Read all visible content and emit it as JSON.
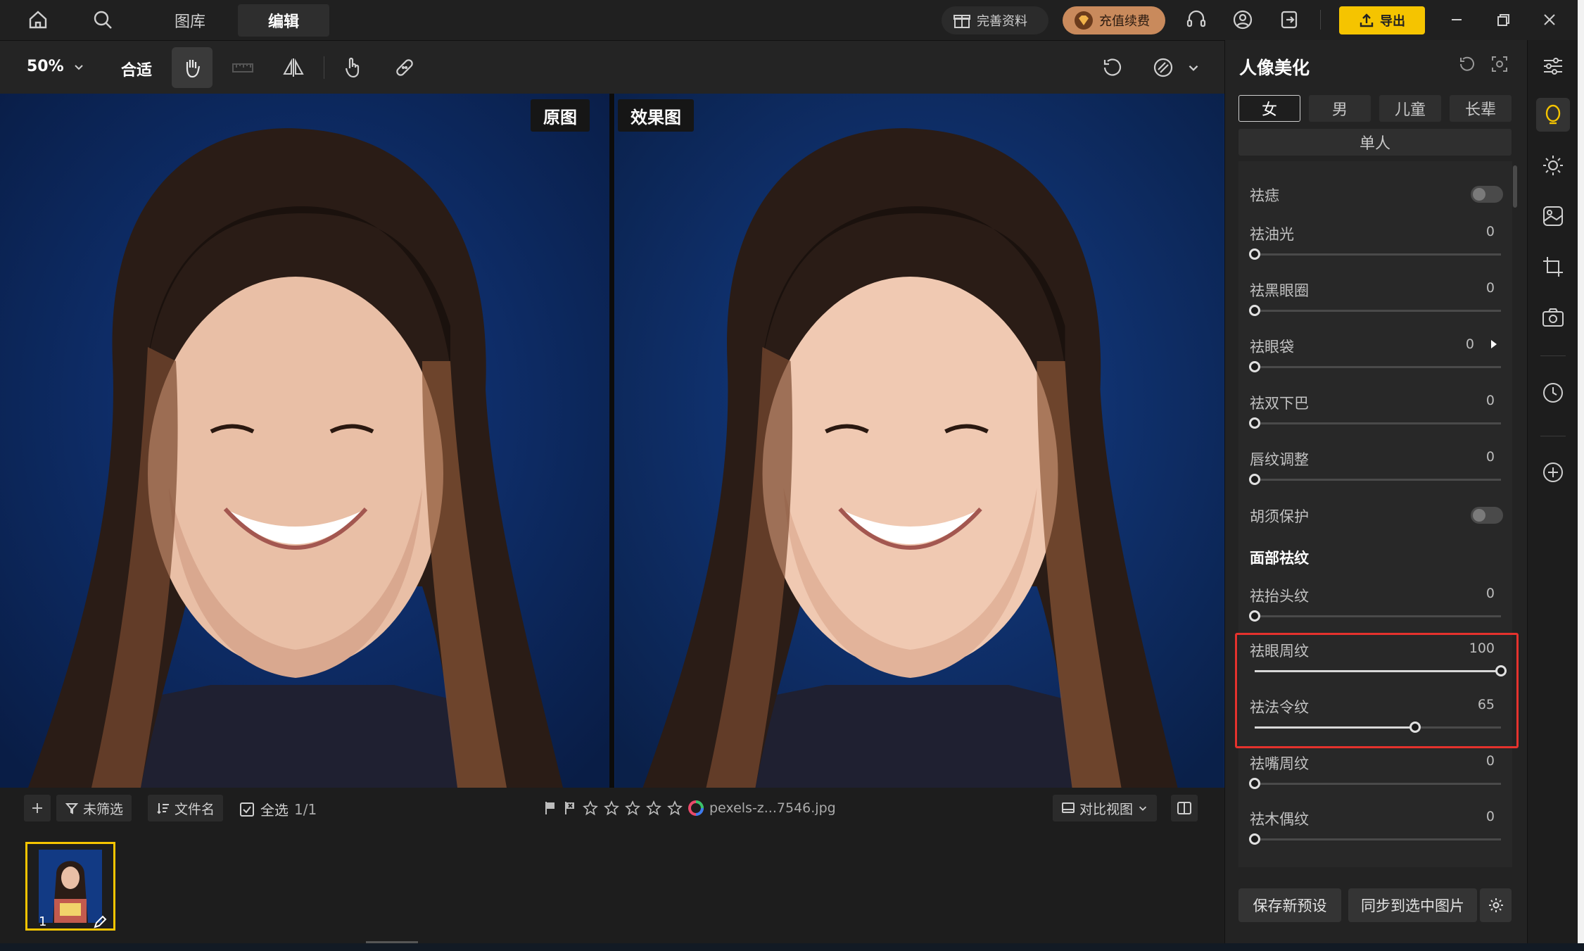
{
  "nav": {
    "tab_library": "图库",
    "tab_edit": "编辑"
  },
  "header": {
    "profile_label": "完善资料",
    "recharge_label": "充值续费",
    "export_label": "导出"
  },
  "toolbar": {
    "zoom": "50%",
    "fit_label": "合适"
  },
  "canvas": {
    "original_label": "原图",
    "effect_label": "效果图"
  },
  "filmstrip": {
    "filter_label": "未筛选",
    "sort_label": "文件名",
    "select_all_label": "全选",
    "count": "1/1",
    "filename": "pexels-z...7546.jpg",
    "view_mode_label": "对比视图",
    "thumb_index": "1"
  },
  "panel": {
    "title": "人像美化",
    "gender_tabs": [
      "女",
      "男",
      "儿童",
      "长辈"
    ],
    "mode_label": "单人",
    "items": [
      {
        "label": "祛痣",
        "kind": "toggle",
        "on": false
      },
      {
        "label": "祛油光",
        "value": "0",
        "fraction": 0
      },
      {
        "label": "祛黑眼圈",
        "value": "0",
        "fraction": 0
      },
      {
        "label": "祛眼袋",
        "value": "0",
        "fraction": 0
      },
      {
        "label": "祛双下巴",
        "value": "0",
        "fraction": 0
      },
      {
        "label": "唇纹调整",
        "value": "0",
        "fraction": 0
      },
      {
        "label": "胡须保护",
        "kind": "toggle",
        "on": false
      }
    ],
    "section_title": "面部祛纹",
    "wrinkles": [
      {
        "label": "祛抬头纹",
        "value": "0",
        "fraction": 0
      },
      {
        "label": "祛眼周纹",
        "value": "100",
        "fraction": 1
      },
      {
        "label": "祛法令纹",
        "value": "65",
        "fraction": 0.65
      },
      {
        "label": "祛嘴周纹",
        "value": "0",
        "fraction": 0
      },
      {
        "label": "祛木偶纹",
        "value": "0",
        "fraction": 0
      }
    ],
    "save_preset_label": "保存新预设",
    "sync_label": "同步到选中图片"
  },
  "colors": {
    "accent": "#f5c400",
    "highlight": "#e5322d",
    "photo_bg": "#0e2c66"
  }
}
